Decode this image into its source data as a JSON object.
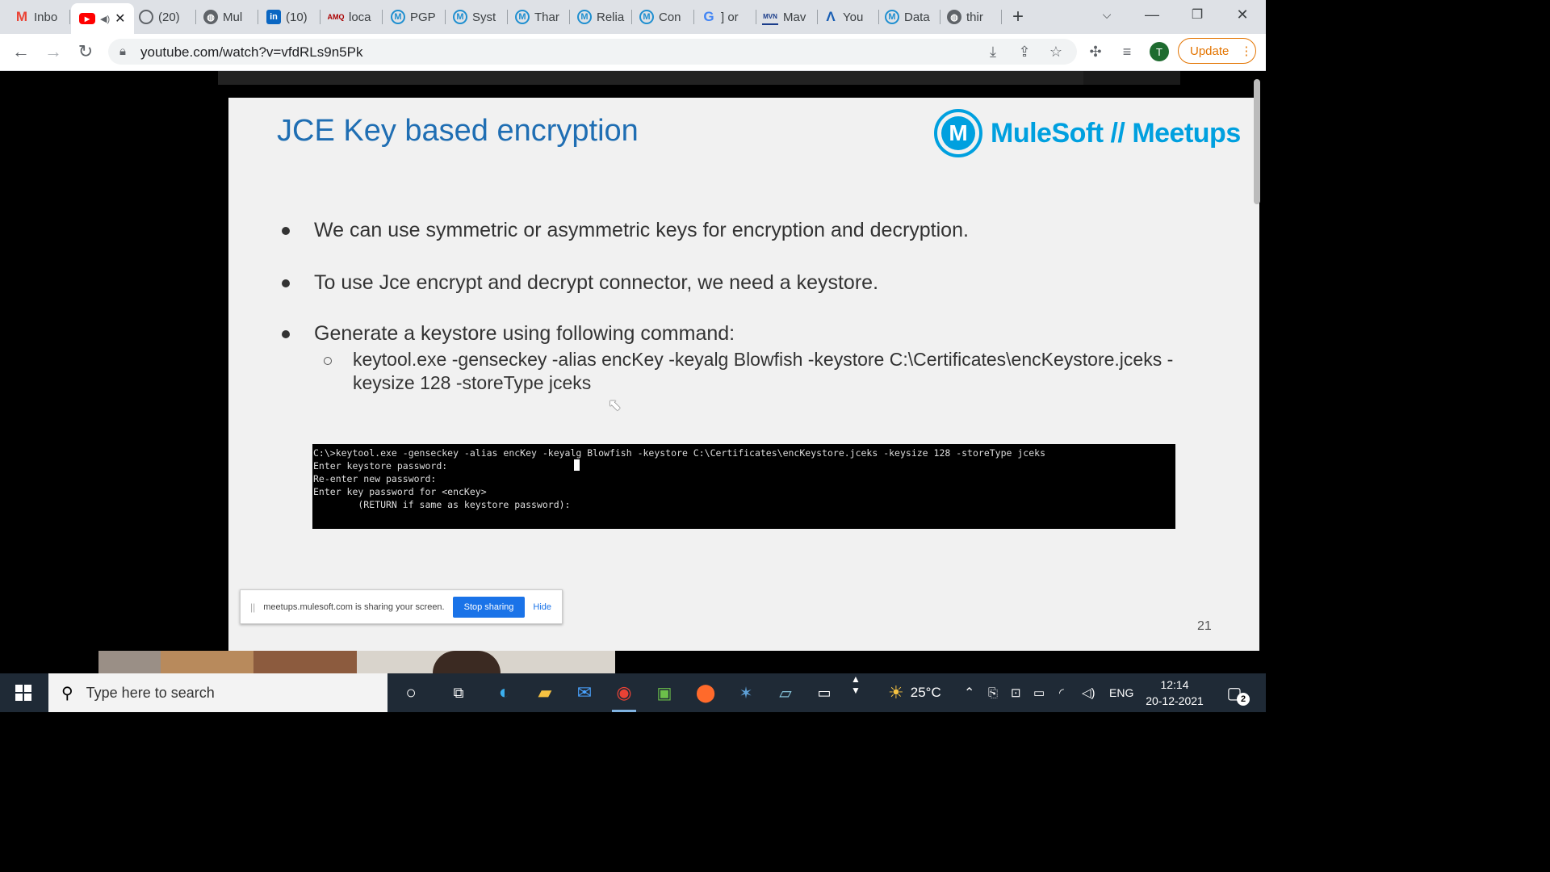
{
  "browser": {
    "tabs": [
      {
        "label": "Inbo",
        "icon": "gmail-icon"
      },
      {
        "label": "",
        "icon": "youtube-icon",
        "active": true
      },
      {
        "label": "(20)",
        "icon": "app-icon"
      },
      {
        "label": "Mul",
        "icon": "globe-icon"
      },
      {
        "label": "(10)",
        "icon": "linkedin-icon"
      },
      {
        "label": "loca",
        "icon": "amq-icon"
      },
      {
        "label": "PGP",
        "icon": "mulesoft-icon"
      },
      {
        "label": "Syst",
        "icon": "mulesoft-icon"
      },
      {
        "label": "Thar",
        "icon": "mulesoft-icon"
      },
      {
        "label": "Relia",
        "icon": "mulesoft-icon"
      },
      {
        "label": "Con",
        "icon": "mulesoft-icon"
      },
      {
        "label": "] or",
        "icon": "google-icon"
      },
      {
        "label": "Mav",
        "icon": "mvn-icon"
      },
      {
        "label": "You",
        "icon": "mulesoft-m-icon"
      },
      {
        "label": "Data",
        "icon": "mulesoft-icon"
      },
      {
        "label": "thir",
        "icon": "globe-icon"
      }
    ],
    "new_tab": "+",
    "url": "youtube.com/watch?v=vfdRLs9n5Pk",
    "profile_initial": "T",
    "update_label": "Update"
  },
  "slide": {
    "title": "JCE Key based encryption",
    "logo_mark": "M",
    "logo_text": "MuleSoft // Meetups",
    "bullets": [
      "We can use symmetric or asymmetric keys for encryption and decryption.",
      "To use Jce encrypt and decrypt connector, we need a keystore.",
      "Generate a keystore using following command:"
    ],
    "sub_bullet": "keytool.exe -genseckey -alias encKey -keyalg Blowfish -keystore C:\\Certificates\\encKeystore.jceks -keysize 128 -storeType jceks",
    "terminal_lines": [
      "C:\\>keytool.exe -genseckey -alias encKey -keyalg Blowfish -keystore C:\\Certificates\\encKeystore.jceks -keysize 128 -storeType jceks",
      "Enter keystore password:",
      "Re-enter new password:",
      "Enter key password for <encKey>",
      "        (RETURN if same as keystore password):"
    ],
    "share_bar": {
      "message": "meetups.mulesoft.com is sharing your screen.",
      "stop_label": "Stop sharing",
      "hide_label": "Hide"
    },
    "page_number": "21"
  },
  "taskbar": {
    "search_placeholder": "Type here to search",
    "weather": "25°C",
    "language": "ENG",
    "time": "12:14",
    "date": "20-12-2021",
    "notification_count": "2"
  },
  "colors": {
    "title_blue": "#1f6eb3",
    "mulesoft_blue": "#00a0df",
    "update_orange": "#e37400",
    "taskbar_bg": "#1f2a36"
  }
}
